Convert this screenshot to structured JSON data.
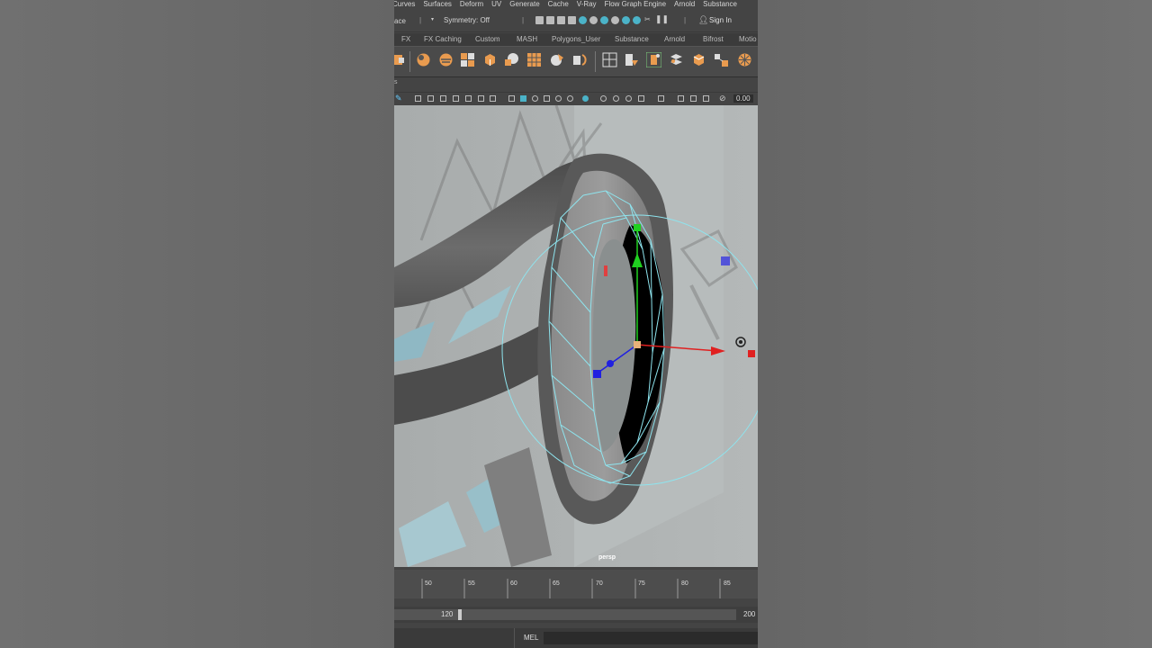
{
  "menu": [
    "Curves",
    "Surfaces",
    "Deform",
    "UV",
    "Generate",
    "Cache",
    "V-Ray",
    "Flow Graph Engine",
    "Arnold",
    "Substance"
  ],
  "status": {
    "workspace_fragment": "ace",
    "symmetry": "Symmetry: Off",
    "sign_in": "Sign In"
  },
  "shelf_tabs": [
    "FX",
    "FX Caching",
    "Custom",
    "MASH",
    "Polygons_User",
    "Substance",
    "Arnold",
    "Bifrost",
    "Motio"
  ],
  "viewport": {
    "label": "persp",
    "field_value": "0.00"
  },
  "timeline": {
    "ticks": [
      "50",
      "55",
      "60",
      "65",
      "70",
      "75",
      "80",
      "85"
    ]
  },
  "range": {
    "start": "120",
    "end": "200"
  },
  "command": {
    "language": "MEL"
  },
  "colors": {
    "accent": "#e99b4f",
    "selection": "#8ee4ee",
    "axis_x": "#e02020",
    "axis_y": "#20d020",
    "axis_z": "#2020e0"
  }
}
